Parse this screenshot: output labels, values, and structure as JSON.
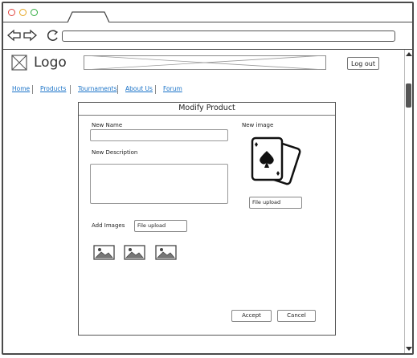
{
  "window": {
    "controls": [
      "close-dot",
      "minimize-dot",
      "maximize-dot"
    ]
  },
  "header": {
    "logo_text": "Logo",
    "logout_label": "Log out"
  },
  "nav": {
    "items": [
      {
        "label": "Home"
      },
      {
        "label": "Products"
      },
      {
        "label": "Tournaments"
      },
      {
        "label": "About Us"
      },
      {
        "label": "Forum"
      }
    ]
  },
  "form": {
    "title": "Modify Product",
    "new_name_label": "New Name",
    "new_description_label": "New Description",
    "new_image_label": "New image",
    "file_upload_label": "File upload",
    "add_images_label": "Add   Images",
    "add_images_upload_label": "File upload",
    "accept_label": "Accept",
    "cancel_label": "Cancel"
  },
  "colors": {
    "link": "#1a73c8",
    "close": "#e0443e",
    "minimize": "#e5a51f",
    "maximize": "#2eab3e"
  }
}
